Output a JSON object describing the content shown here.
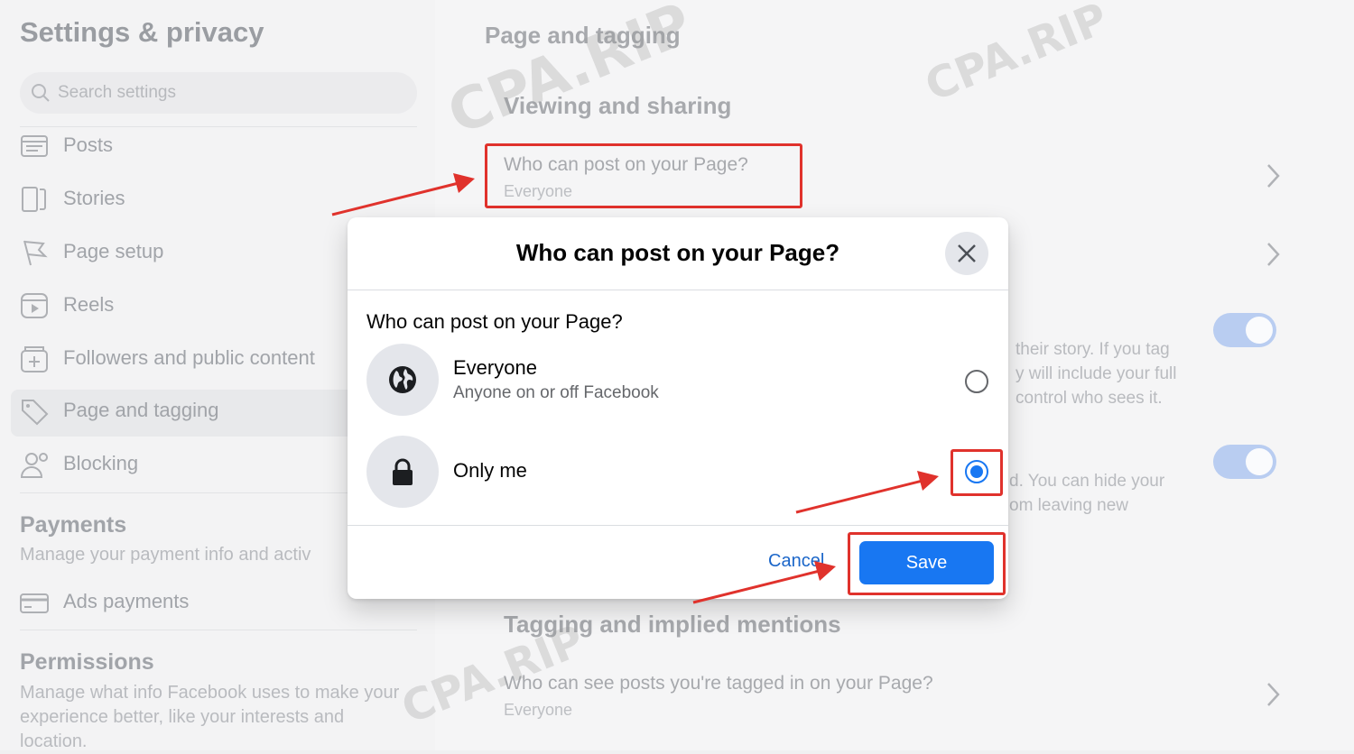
{
  "sidebar": {
    "title": "Settings & privacy",
    "search_placeholder": "Search settings",
    "items": [
      {
        "label": "Posts",
        "icon": "posts-icon"
      },
      {
        "label": "Stories",
        "icon": "stories-icon"
      },
      {
        "label": "Page setup",
        "icon": "flag-icon"
      },
      {
        "label": "Reels",
        "icon": "reels-icon"
      },
      {
        "label": "Followers and public content",
        "icon": "followers-icon"
      },
      {
        "label": "Page and tagging",
        "icon": "tag-icon"
      },
      {
        "label": "Blocking",
        "icon": "blocking-icon"
      }
    ],
    "payments": {
      "title": "Payments",
      "desc": "Manage your payment info and activ",
      "item": "Ads payments"
    },
    "permissions": {
      "title": "Permissions",
      "desc": "Manage what info Facebook uses to make your experience better, like your interests and location."
    }
  },
  "main": {
    "title": "Page and tagging",
    "viewing_section": "Viewing and sharing",
    "row1_title": "Who can post on your Page?",
    "row1_sub": "Everyone",
    "story_text": "their story. If you tag\ny will include your full\ncontrol who sees it.",
    "hide_text": "d. You can hide your\nom leaving new",
    "tagging_section": "Tagging and implied mentions",
    "row2_title": "Who can see posts you're tagged in on your Page?",
    "row2_sub": "Everyone"
  },
  "dialog": {
    "title": "Who can post on your Page?",
    "question": "Who can post on your Page?",
    "options": [
      {
        "title": "Everyone",
        "subtitle": "Anyone on or off Facebook",
        "selected": false,
        "icon": "globe-icon"
      },
      {
        "title": "Only me",
        "subtitle": "",
        "selected": true,
        "icon": "lock-icon"
      }
    ],
    "cancel": "Cancel",
    "save": "Save"
  },
  "watermark": "CPA.RIP",
  "colors": {
    "accent": "#1877f2",
    "highlight": "#e0322c"
  }
}
